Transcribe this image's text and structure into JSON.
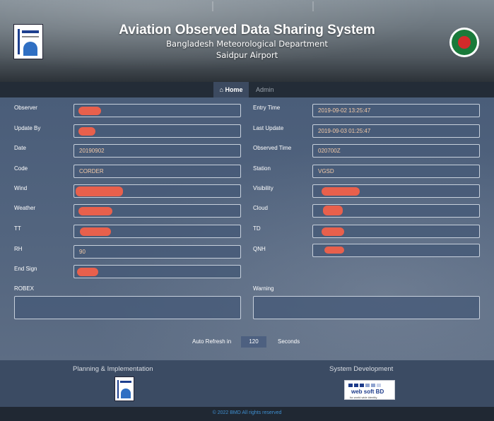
{
  "header": {
    "title": "Aviation Observed Data Sharing System",
    "department": "Bangladesh Meteorological Department",
    "airport": "Saidpur Airport"
  },
  "nav": {
    "home_label": "Home",
    "admin_label": "Admin"
  },
  "form": {
    "observer": {
      "label": "Observer",
      "value": ""
    },
    "entry_time": {
      "label": "Entry Time",
      "value": "2019-09-02 13:25:47"
    },
    "update_by": {
      "label": "Update By",
      "value": ""
    },
    "last_update": {
      "label": "Last Update",
      "value": "2019-09-03 01:25:47"
    },
    "date": {
      "label": "Date",
      "value": "20190902"
    },
    "observed_time": {
      "label": "Observed Time",
      "value": "020700Z"
    },
    "code": {
      "label": "Code",
      "value": "CORDER"
    },
    "station": {
      "label": "Station",
      "value": "VGSD"
    },
    "wind": {
      "label": "Wind",
      "value": ""
    },
    "visibility": {
      "label": "Visibility",
      "value": ""
    },
    "weather": {
      "label": "Weather",
      "value": ""
    },
    "cloud": {
      "label": "Cloud",
      "value": ""
    },
    "tt": {
      "label": "TT",
      "value": ""
    },
    "td": {
      "label": "TD",
      "value": ""
    },
    "rh": {
      "label": "RH",
      "value": "90"
    },
    "qnh": {
      "label": "QNH",
      "value": ""
    },
    "end_sign": {
      "label": "End Sign",
      "value": ""
    },
    "robex": {
      "label": "ROBEX",
      "value": ""
    },
    "warning": {
      "label": "Warning",
      "value": ""
    }
  },
  "refresh": {
    "prefix": "Auto Refresh in",
    "value": "120",
    "suffix": "Seconds"
  },
  "footer": {
    "planning_label": "Planning & Implementation",
    "development_label": "System Development",
    "websoft_name": "web soft BD",
    "websoft_tagline": "for world wide identity",
    "copyright": "© 2022 BMD All rights reserved"
  },
  "colors": {
    "redaction": "#e8604c",
    "value_text": "#f3c9a6",
    "copyright_text": "#3f8fd0"
  }
}
